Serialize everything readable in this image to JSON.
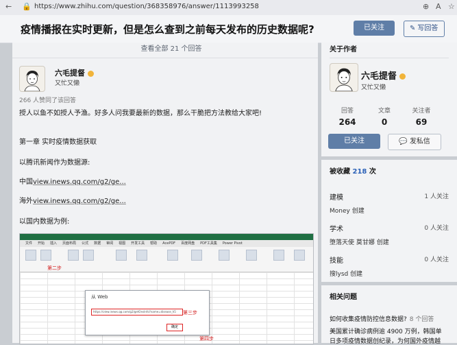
{
  "browser": {
    "url": "https://www.zhihu.com/question/368358976/answer/1113993258"
  },
  "question": {
    "title": "疫情播报在实时更新，但是怎么查到之前每天发布的历史数据呢?",
    "follow_label": "已关注",
    "write_label": "写回答"
  },
  "answer": {
    "view_all": "查看全部 21 个回答",
    "author_name": "六毛提督",
    "author_bio": "又忙又懒",
    "upvotes": "266 人赞同了该回答",
    "p1": "授人以鱼不如授人予渔。好多人问我要最新的数据，那么干脆把方法教给大家吧!",
    "p2": "第一章 实时疫情数据获取",
    "p3": "以腾讯新闻作为数据源:",
    "p4_prefix": "中国",
    "p4_link": "view.inews.qq.com/g2/ge...",
    "p5_prefix": "海外",
    "p5_link": "view.inews.qq.com/g2/ge...",
    "p6": "以国内数据为例:",
    "excel": {
      "tabs": [
        "文件",
        "开始",
        "插入",
        "页面布局",
        "公式",
        "数据",
        "审阅",
        "视图",
        "开发工具",
        "帮助",
        "AcePDF",
        "百度网盘",
        "PDF工具集",
        "Power Pivot"
      ],
      "step2": "第二步",
      "step3": "第三步",
      "step4": "第四步",
      "dialog_title": "从 Web",
      "dialog_url": "https://view.inews.qq.com/g2/getOnsInfo?name=disease_h5",
      "dialog_ok": "确定"
    }
  },
  "sidebar": {
    "about_title": "关于作者",
    "author_name": "六毛提督",
    "author_bio": "又忙又懒",
    "stats": [
      {
        "label": "回答",
        "value": "264"
      },
      {
        "label": "文章",
        "value": "0"
      },
      {
        "label": "关注者",
        "value": "69"
      }
    ],
    "follow_label": "已关注",
    "message_label": "发私信",
    "fav_title": "被收藏",
    "fav_count": "218",
    "fav_unit": "次",
    "favorites": [
      {
        "name": "建模",
        "count": "1 人关注",
        "creator": "Money 创建"
      },
      {
        "name": "学术",
        "count": "0 人关注",
        "creator": "堕落天使 莫甘娜 创建"
      },
      {
        "name": "技能",
        "count": "0 人关注",
        "creator": "搜lysd 创建"
      }
    ],
    "related_title": "相关问题",
    "related": [
      {
        "title": "如何收集疫情防控信息数据?",
        "count": "8 个回答"
      },
      {
        "title": "美国累计确诊病例逾 4900 万例，韩国单",
        "count": ""
      },
      {
        "title": "日多项疫情数据创纪录，为何国外疫情越",
        "count": ""
      }
    ]
  }
}
